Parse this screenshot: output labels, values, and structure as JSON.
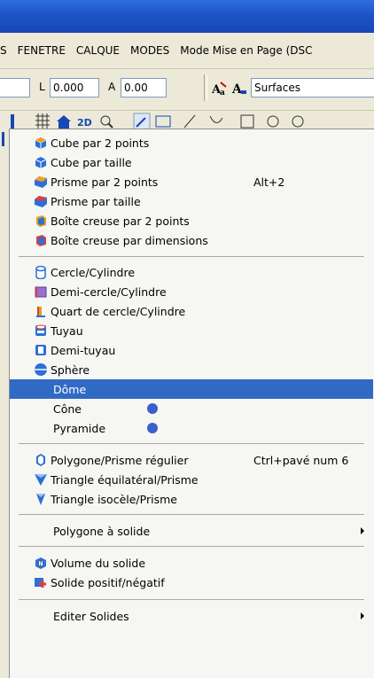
{
  "menubar": {
    "items": [
      "S",
      "FENETRE",
      "CALQUE",
      "MODES",
      "Mode Mise en Page (DSC"
    ]
  },
  "toolbar": {
    "l_label": "L",
    "l_value": "0.000",
    "a_label": "A",
    "a_value": "0.00",
    "layer_value": "Surfaces"
  },
  "menu": {
    "items": [
      {
        "label": "Cube par 2 points",
        "icon": "cube-icon"
      },
      {
        "label": "Cube par taille",
        "icon": "cube-size-icon"
      },
      {
        "label": "Prisme par 2 points",
        "icon": "prism-icon",
        "shortcut": "Alt+2"
      },
      {
        "label": "Prisme par taille",
        "icon": "prism-size-icon"
      },
      {
        "label": "Boîte creuse par 2 points",
        "icon": "hollow-box-icon"
      },
      {
        "label": "Boîte creuse par dimensions",
        "icon": "hollow-box-dim-icon"
      },
      {
        "label": "Cercle/Cylindre",
        "icon": "cylinder-icon"
      },
      {
        "label": "Demi-cercle/Cylindre",
        "icon": "half-cylinder-icon"
      },
      {
        "label": "Quart de cercle/Cylindre",
        "icon": "quarter-cylinder-icon"
      },
      {
        "label": "Tuyau",
        "icon": "pipe-icon"
      },
      {
        "label": "Demi-tuyau",
        "icon": "half-pipe-icon"
      },
      {
        "label": "Sphère",
        "icon": "sphere-icon"
      },
      {
        "label": "Dôme",
        "selected": true
      },
      {
        "label": "Cône"
      },
      {
        "label": "Pyramide"
      },
      {
        "label": "Polygone/Prisme régulier",
        "icon": "polygon-prism-icon",
        "shortcut": "Ctrl+pavé num 6"
      },
      {
        "label": "Triangle équilatéral/Prisme",
        "icon": "equilateral-triangle-icon"
      },
      {
        "label": "Triangle isocèle/Prisme",
        "icon": "isosceles-triangle-icon"
      },
      {
        "label": "Polygone à solide",
        "submenu": true
      },
      {
        "label": "Volume du solide",
        "icon": "volume-icon"
      },
      {
        "label": "Solide positif/négatif",
        "icon": "solid-sign-icon"
      },
      {
        "label": "Editer Solides",
        "submenu": true
      }
    ]
  },
  "colors": {
    "selection": "#316ac5",
    "titlebar": "#1e56c8",
    "dot": "#3a5fcd"
  }
}
